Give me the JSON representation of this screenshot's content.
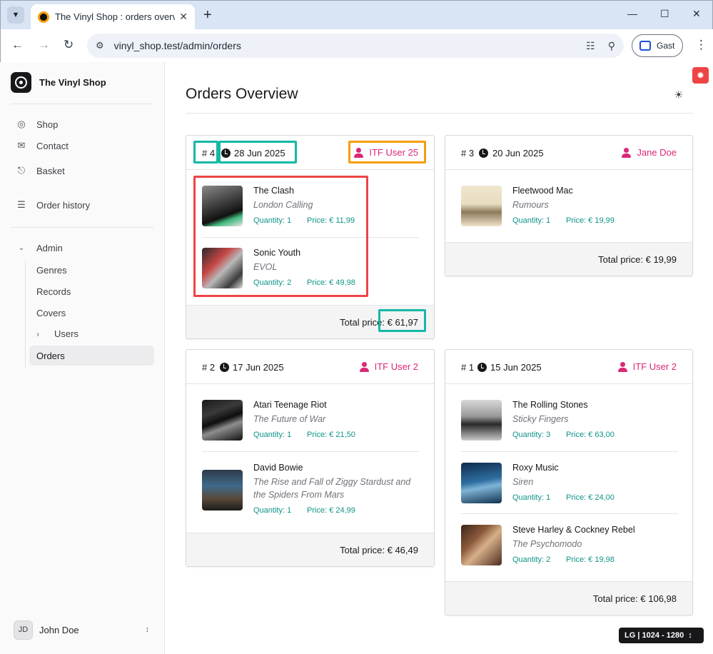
{
  "browser": {
    "tab_title": "The Vinyl Shop : orders overview",
    "url": "vinyl_shop.test/admin/orders",
    "profile_label": "Gast"
  },
  "sidebar": {
    "brand": "The Vinyl Shop",
    "items": [
      {
        "label": "Shop",
        "icon": "disc-icon"
      },
      {
        "label": "Contact",
        "icon": "mail-icon"
      },
      {
        "label": "Basket",
        "icon": "cart-icon"
      },
      {
        "label": "Order history",
        "icon": "list-icon"
      }
    ],
    "admin": {
      "label": "Admin",
      "items": [
        "Genres",
        "Records",
        "Covers",
        "Users",
        "Orders"
      ],
      "active": "Orders"
    },
    "user": {
      "initials": "JD",
      "name": "John Doe"
    }
  },
  "main": {
    "title": "Orders Overview"
  },
  "orders": [
    {
      "number": "# 4",
      "date": "28 Jun 2025",
      "user": "ITF User 25",
      "items": [
        {
          "artist": "The Clash",
          "album": "London Calling",
          "qty": "Quantity: 1",
          "price": "Price: € 11,99"
        },
        {
          "artist": "Sonic Youth",
          "album": "EVOL",
          "qty": "Quantity: 2",
          "price": "Price: € 49,98"
        }
      ],
      "total": "Total price: € 61,97"
    },
    {
      "number": "# 3",
      "date": "20 Jun 2025",
      "user": "Jane Doe",
      "items": [
        {
          "artist": "Fleetwood Mac",
          "album": "Rumours",
          "qty": "Quantity: 1",
          "price": "Price: € 19,99"
        }
      ],
      "total": "Total price: € 19,99"
    },
    {
      "number": "# 2",
      "date": "17 Jun 2025",
      "user": "ITF User 2",
      "items": [
        {
          "artist": "Atari Teenage Riot",
          "album": "The Future of War",
          "qty": "Quantity: 1",
          "price": "Price: € 21,50"
        },
        {
          "artist": "David Bowie",
          "album": "The Rise and Fall of Ziggy Stardust and the Spiders From Mars",
          "qty": "Quantity: 1",
          "price": "Price: € 24,99"
        }
      ],
      "total": "Total price: € 46,49"
    },
    {
      "number": "# 1",
      "date": "15 Jun 2025",
      "user": "ITF User 2",
      "items": [
        {
          "artist": "The Rolling Stones",
          "album": "Sticky Fingers",
          "qty": "Quantity: 3",
          "price": "Price: € 63,00"
        },
        {
          "artist": "Roxy Music",
          "album": "Siren",
          "qty": "Quantity: 1",
          "price": "Price: € 24,00"
        },
        {
          "artist": "Steve Harley & Cockney Rebel",
          "album": "The Psychomodo",
          "qty": "Quantity: 2",
          "price": "Price: € 19,98"
        }
      ],
      "total": "Total price: € 106,98"
    }
  ],
  "breakpoint_badge": "LG | 1024 - 1280",
  "colors": {
    "accent_teal": "#0d9488",
    "user_pink": "#db2777",
    "highlight_teal": "#14b8a6",
    "highlight_orange": "#f59e0b",
    "highlight_red": "#ef4444"
  }
}
